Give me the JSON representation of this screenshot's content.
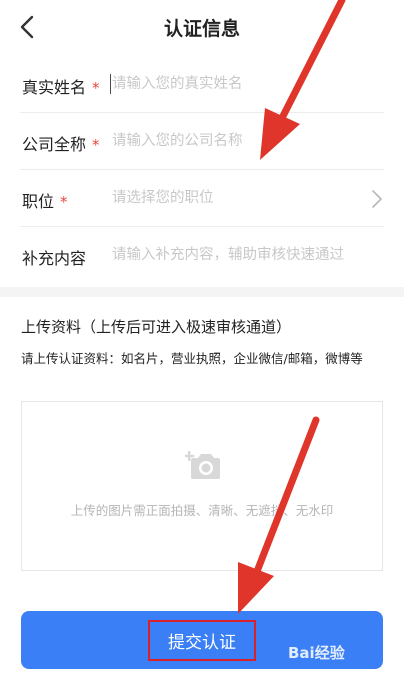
{
  "header": {
    "title": "认证信息"
  },
  "form": {
    "rows": [
      {
        "label": "真实姓名",
        "required": "*",
        "placeholder": "请输入您的真实姓名"
      },
      {
        "label": "公司全称",
        "required": "*",
        "placeholder": "请输入您的公司名称"
      },
      {
        "label": "职位",
        "required": "*",
        "placeholder": "请选择您的职位"
      },
      {
        "label": "补充内容",
        "required": "",
        "placeholder": "请输入补充内容，辅助审核快速通过"
      }
    ]
  },
  "upload": {
    "title": "上传资料（上传后可进入极速审核通道）",
    "description": "请上传认证资料：如名片，营业执照，企业微信/邮箱，微博等",
    "hint": "上传的图片需正面拍摄、清晰、无遮挡、无水印"
  },
  "submit": {
    "label": "提交认证"
  },
  "watermark": {
    "text": "Bai经验"
  },
  "colors": {
    "accent": "#3a7ff5",
    "required": "#e8453c",
    "annotation": "#e0352b"
  },
  "icons": {
    "back": "chevron-left-icon",
    "position_select": "chevron-right-icon",
    "upload": "camera-plus-icon"
  }
}
